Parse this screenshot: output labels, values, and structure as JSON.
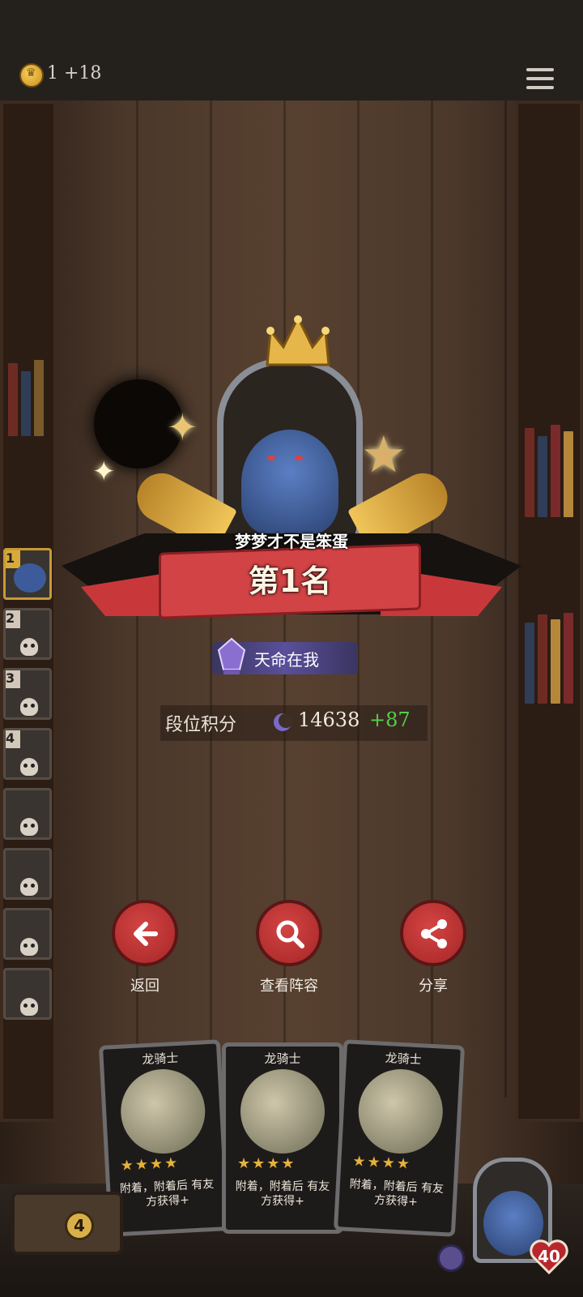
{
  "topbar": {
    "coin_text": "1 +18",
    "coin_icon": "crown-coin-icon",
    "menu_icon": "menu-icon"
  },
  "result": {
    "player_name": "梦梦才不是笨蛋",
    "rank_text": "第1名",
    "title_badge": "天命在我",
    "score_label": "段位积分",
    "score_value": "14638",
    "score_gain": "+87"
  },
  "sidebar": {
    "items": [
      {
        "num": "1",
        "highlighted": true
      },
      {
        "num": "2"
      },
      {
        "num": "3"
      },
      {
        "num": "4"
      },
      {
        "num": ""
      },
      {
        "num": ""
      },
      {
        "num": ""
      },
      {
        "num": ""
      }
    ]
  },
  "actions": {
    "back": "返回",
    "view_lineup": "查看阵容",
    "share": "分享"
  },
  "cards": [
    {
      "name": "龙骑士",
      "stars": "★★★★",
      "desc": "附着，附着后 有友方获得+"
    },
    {
      "name": "龙骑士",
      "stars": "★★★★",
      "desc": "附着，附着后 有友方获得+"
    },
    {
      "name": "龙骑士",
      "stars": "★★★★",
      "desc": "附着，附着后 有友方获得+"
    }
  ],
  "bottom": {
    "coin_count": "4",
    "health": "40"
  },
  "colors": {
    "ribbon": "#d24345",
    "gain": "#52d04a",
    "gold": "#e9c474"
  }
}
